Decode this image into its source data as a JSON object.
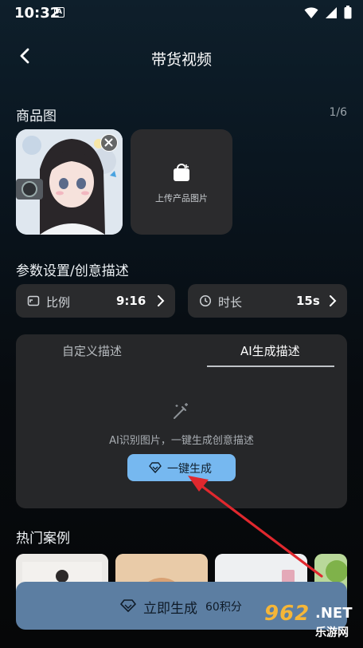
{
  "status_bar": {
    "time": "10:32",
    "notification_badge": "A"
  },
  "header": {
    "title": "带货视频"
  },
  "product_images": {
    "label": "商品图",
    "count": "1/6",
    "upload_label": "上传产品图片"
  },
  "params": {
    "label": "参数设置/创意描述",
    "ratio": {
      "name": "比例",
      "value": "9:16"
    },
    "duration": {
      "name": "时长",
      "value": "15s"
    }
  },
  "description_panel": {
    "tabs": [
      "自定义描述",
      "AI生成描述"
    ],
    "active_tab": "AI生成描述",
    "hint": "AI识别图片，一键生成创意描述",
    "generate_button": "一键生成"
  },
  "cases": {
    "label": "热门案例"
  },
  "cta": {
    "label": "立即生成",
    "points": "60积分"
  },
  "watermark": {
    "number": "962",
    "domain": ".NET",
    "site": "乐游网"
  },
  "colors": {
    "accent": "#76b8f0",
    "cta": "#5c7ea2",
    "annotation_arrow": "#e0282e"
  }
}
